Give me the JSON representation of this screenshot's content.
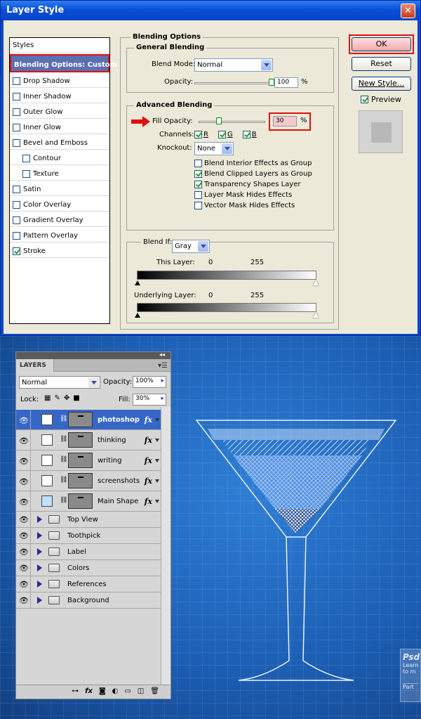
{
  "dialog": {
    "title": "Layer Style",
    "close_glyph": "✕",
    "styles_header": "Styles",
    "style_items": [
      {
        "label": "Blending Options: Custom",
        "selected": true,
        "checkbox": false,
        "checked": false,
        "indent": false
      },
      {
        "label": "Drop Shadow",
        "selected": false,
        "checkbox": true,
        "checked": false,
        "indent": false
      },
      {
        "label": "Inner Shadow",
        "selected": false,
        "checkbox": true,
        "checked": false,
        "indent": false
      },
      {
        "label": "Outer Glow",
        "selected": false,
        "checkbox": true,
        "checked": false,
        "indent": false
      },
      {
        "label": "Inner Glow",
        "selected": false,
        "checkbox": true,
        "checked": false,
        "indent": false
      },
      {
        "label": "Bevel and Emboss",
        "selected": false,
        "checkbox": true,
        "checked": false,
        "indent": false
      },
      {
        "label": "Contour",
        "selected": false,
        "checkbox": true,
        "checked": false,
        "indent": true
      },
      {
        "label": "Texture",
        "selected": false,
        "checkbox": true,
        "checked": false,
        "indent": true
      },
      {
        "label": "Satin",
        "selected": false,
        "checkbox": true,
        "checked": false,
        "indent": false
      },
      {
        "label": "Color Overlay",
        "selected": false,
        "checkbox": true,
        "checked": false,
        "indent": false
      },
      {
        "label": "Gradient Overlay",
        "selected": false,
        "checkbox": true,
        "checked": false,
        "indent": false
      },
      {
        "label": "Pattern Overlay",
        "selected": false,
        "checkbox": true,
        "checked": false,
        "indent": false
      },
      {
        "label": "Stroke",
        "selected": false,
        "checkbox": true,
        "checked": true,
        "indent": false
      }
    ],
    "blending_options": {
      "title": "Blending Options",
      "general": {
        "title": "General Blending",
        "blend_mode_label": "Blend Mode:",
        "blend_mode_value": "Normal",
        "opacity_label": "Opacity:",
        "opacity_value": "100",
        "opacity_level": 100,
        "percent": "%"
      },
      "advanced": {
        "title": "Advanced Blending",
        "fill_opacity_label": "Fill Opacity:",
        "fill_opacity_value": "30",
        "fill_opacity_level": 30,
        "percent": "%",
        "channels_label": "Channels:",
        "channels": [
          {
            "label": "R",
            "checked": true
          },
          {
            "label": "G",
            "checked": true
          },
          {
            "label": "B",
            "checked": true
          }
        ],
        "knockout_label": "Knockout:",
        "knockout_value": "None",
        "options": [
          {
            "label": "Blend Interior Effects as Group",
            "checked": false
          },
          {
            "label": "Blend Clipped Layers as Group",
            "checked": true
          },
          {
            "label": "Transparency Shapes Layer",
            "checked": true
          },
          {
            "label": "Layer Mask Hides Effects",
            "checked": false
          },
          {
            "label": "Vector Mask Hides Effects",
            "checked": false
          }
        ]
      },
      "blend_if": {
        "label": "Blend If:",
        "value": "Gray",
        "this_layer_label": "This Layer:",
        "this_layer_min": "0",
        "this_layer_max": "255",
        "underlying_label": "Underlying Layer:",
        "underlying_min": "0",
        "underlying_max": "255"
      }
    },
    "buttons": {
      "ok": "OK",
      "reset": "Reset",
      "new_style": "New Style...",
      "preview_label": "Preview",
      "preview_checked": true
    },
    "colors": {
      "highlight_red": "#e01010",
      "selected_bg": "#5b6fb1",
      "arrow_red": "#e01010"
    }
  },
  "layers_panel": {
    "tab_label": "LAYERS",
    "blend_mode": "Normal",
    "opacity_label": "Opacity:",
    "opacity_value": "100%",
    "lock_label": "Lock:",
    "fill_label": "Fill:",
    "fill_value": "30%",
    "layers": [
      {
        "name": "photoshop",
        "selected": true,
        "fx": "fx"
      },
      {
        "name": "thinking",
        "selected": false,
        "fx": "fx"
      },
      {
        "name": "writing",
        "selected": false,
        "fx": "fx"
      },
      {
        "name": "screenshots",
        "selected": false,
        "fx": "fx"
      },
      {
        "name": "Main Shape",
        "selected": false,
        "fx": "fx"
      }
    ],
    "groups": [
      "Top View",
      "Toothpick",
      "Label",
      "Colors",
      "References",
      "Background"
    ],
    "bottom_icons": [
      "link-icon",
      "fx-icon",
      "mask-icon",
      "adjustment-icon",
      "folder-icon",
      "new-layer-icon",
      "trash-icon"
    ],
    "selected_color": "#3767c6"
  },
  "canvas": {
    "psd_card_title": "Psd",
    "psd_card_line1": "Learn",
    "psd_card_line2": "to m",
    "psd_card_part": "Part"
  }
}
